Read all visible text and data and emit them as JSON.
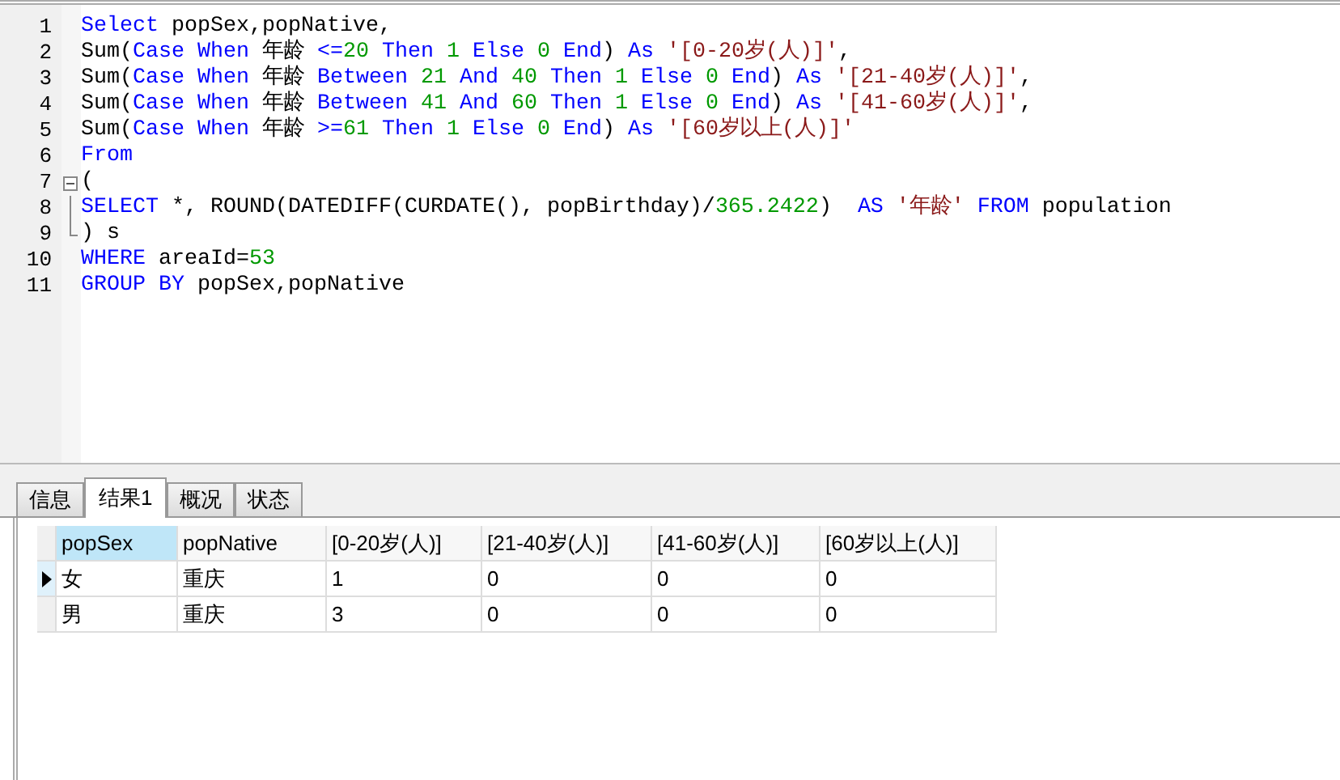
{
  "editor": {
    "lines": [
      {
        "number": "1",
        "kind": "plain",
        "tokens": [
          {
            "kind": "kw",
            "text": "Select"
          },
          {
            "kind": "plain",
            "text": " popSex,popNative,"
          }
        ]
      },
      {
        "number": "2",
        "kind": "plain",
        "tokens": [
          {
            "kind": "plain",
            "text": "Sum("
          },
          {
            "kind": "kw",
            "text": "Case When"
          },
          {
            "kind": "plain",
            "text": " 年龄 "
          },
          {
            "kind": "kw",
            "text": "<="
          },
          {
            "kind": "num",
            "text": "20"
          },
          {
            "kind": "kw",
            "text": " Then "
          },
          {
            "kind": "num",
            "text": "1"
          },
          {
            "kind": "kw",
            "text": " Else "
          },
          {
            "kind": "num",
            "text": "0"
          },
          {
            "kind": "kw",
            "text": " End"
          },
          {
            "kind": "plain",
            "text": ") "
          },
          {
            "kind": "kw",
            "text": "As"
          },
          {
            "kind": "str",
            "text": " '[0-20岁(人)]'"
          },
          {
            "kind": "plain",
            "text": ","
          }
        ]
      },
      {
        "number": "3",
        "kind": "plain",
        "tokens": [
          {
            "kind": "plain",
            "text": "Sum("
          },
          {
            "kind": "kw",
            "text": "Case When"
          },
          {
            "kind": "plain",
            "text": " 年龄 "
          },
          {
            "kind": "kw",
            "text": "Between "
          },
          {
            "kind": "num",
            "text": "21"
          },
          {
            "kind": "kw",
            "text": " And "
          },
          {
            "kind": "num",
            "text": "40"
          },
          {
            "kind": "kw",
            "text": " Then "
          },
          {
            "kind": "num",
            "text": "1"
          },
          {
            "kind": "kw",
            "text": " Else "
          },
          {
            "kind": "num",
            "text": "0"
          },
          {
            "kind": "kw",
            "text": " End"
          },
          {
            "kind": "plain",
            "text": ") "
          },
          {
            "kind": "kw",
            "text": "As"
          },
          {
            "kind": "str",
            "text": " '[21-40岁(人)]'"
          },
          {
            "kind": "plain",
            "text": ","
          }
        ]
      },
      {
        "number": "4",
        "kind": "plain",
        "tokens": [
          {
            "kind": "plain",
            "text": "Sum("
          },
          {
            "kind": "kw",
            "text": "Case When"
          },
          {
            "kind": "plain",
            "text": " 年龄 "
          },
          {
            "kind": "kw",
            "text": "Between "
          },
          {
            "kind": "num",
            "text": "41"
          },
          {
            "kind": "kw",
            "text": " And "
          },
          {
            "kind": "num",
            "text": "60"
          },
          {
            "kind": "kw",
            "text": " Then "
          },
          {
            "kind": "num",
            "text": "1"
          },
          {
            "kind": "kw",
            "text": " Else "
          },
          {
            "kind": "num",
            "text": "0"
          },
          {
            "kind": "kw",
            "text": " End"
          },
          {
            "kind": "plain",
            "text": ") "
          },
          {
            "kind": "kw",
            "text": "As"
          },
          {
            "kind": "str",
            "text": " '[41-60岁(人)]'"
          },
          {
            "kind": "plain",
            "text": ","
          }
        ]
      },
      {
        "number": "5",
        "kind": "plain",
        "tokens": [
          {
            "kind": "plain",
            "text": "Sum("
          },
          {
            "kind": "kw",
            "text": "Case When"
          },
          {
            "kind": "plain",
            "text": " 年龄 "
          },
          {
            "kind": "kw",
            "text": ">="
          },
          {
            "kind": "num",
            "text": "61"
          },
          {
            "kind": "kw",
            "text": " Then "
          },
          {
            "kind": "num",
            "text": "1"
          },
          {
            "kind": "kw",
            "text": " Else "
          },
          {
            "kind": "num",
            "text": "0"
          },
          {
            "kind": "kw",
            "text": " End"
          },
          {
            "kind": "plain",
            "text": ") "
          },
          {
            "kind": "kw",
            "text": "As"
          },
          {
            "kind": "str",
            "text": " '[60岁以上(人)]'"
          }
        ]
      },
      {
        "number": "6",
        "kind": "plain",
        "tokens": [
          {
            "kind": "kw",
            "text": "From"
          }
        ]
      },
      {
        "number": "7",
        "kind": "foldstart",
        "tokens": [
          {
            "kind": "plain",
            "text": "("
          }
        ]
      },
      {
        "number": "8",
        "kind": "foldinner",
        "tokens": [
          {
            "kind": "kw",
            "text": "SELECT"
          },
          {
            "kind": "plain",
            "text": " *, ROUND(DATEDIFF(CURDATE(), popBirthday)/"
          },
          {
            "kind": "num",
            "text": "365.2422"
          },
          {
            "kind": "plain",
            "text": ")  "
          },
          {
            "kind": "kw",
            "text": "AS"
          },
          {
            "kind": "str",
            "text": " '年龄'"
          },
          {
            "kind": "kw",
            "text": " FROM"
          },
          {
            "kind": "plain",
            "text": " population"
          }
        ]
      },
      {
        "number": "9",
        "kind": "foldend",
        "tokens": [
          {
            "kind": "plain",
            "text": ") s"
          }
        ]
      },
      {
        "number": "10",
        "kind": "plain",
        "tokens": [
          {
            "kind": "kw",
            "text": "WHERE"
          },
          {
            "kind": "plain",
            "text": " areaId="
          },
          {
            "kind": "num",
            "text": "53"
          }
        ]
      },
      {
        "number": "11",
        "kind": "plain",
        "tokens": [
          {
            "kind": "kw",
            "text": "GROUP BY"
          },
          {
            "kind": "plain",
            "text": " popSex,popNative"
          }
        ]
      }
    ]
  },
  "tabs": [
    {
      "label": "信息",
      "selected": false
    },
    {
      "label": "结果1",
      "selected": true
    },
    {
      "label": "概况",
      "selected": false
    },
    {
      "label": "状态",
      "selected": false
    }
  ],
  "grid": {
    "columns": [
      {
        "label": "popSex",
        "selected": true
      },
      {
        "label": "popNative",
        "selected": false
      },
      {
        "label": "[0-20岁(人)]",
        "selected": false
      },
      {
        "label": "[21-40岁(人)]",
        "selected": false
      },
      {
        "label": "[41-60岁(人)]",
        "selected": false
      },
      {
        "label": "[60岁以上(人)]",
        "selected": false
      }
    ],
    "rows": [
      {
        "current": true,
        "cells": [
          "女",
          "重庆",
          "1",
          "0",
          "0",
          "0"
        ]
      },
      {
        "current": false,
        "cells": [
          "男",
          "重庆",
          "3",
          "0",
          "0",
          "0"
        ]
      }
    ]
  }
}
